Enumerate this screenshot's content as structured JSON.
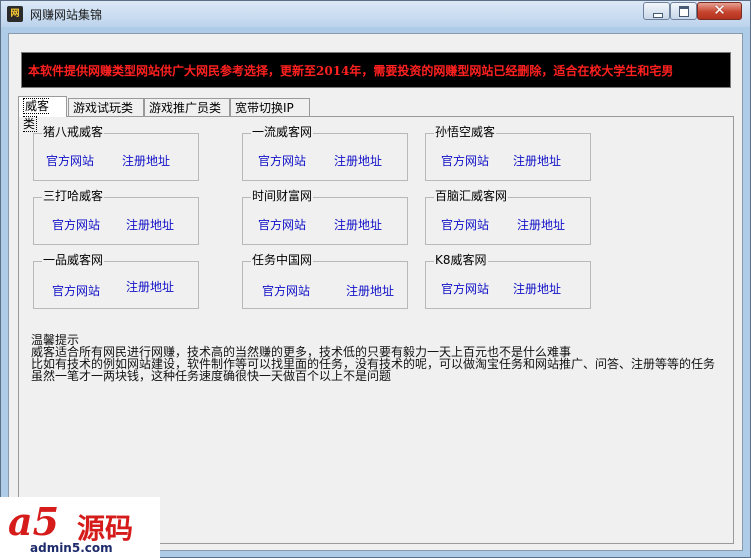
{
  "window": {
    "title": "网赚网站集锦"
  },
  "banner": {
    "text": "本软件提供网赚类型网站供广大网民参考选择，更新至2014年，需要投资的网赚型网站已经删除，适合在校大学生和宅男"
  },
  "tabs": [
    {
      "label": "威客类"
    },
    {
      "label": "游戏试玩类"
    },
    {
      "label": "游戏推广员类"
    },
    {
      "label": "宽带切换IP"
    }
  ],
  "sites": [
    {
      "name": "猪八戒威客",
      "official": "官方网站",
      "register": "注册地址"
    },
    {
      "name": "一流威客网",
      "official": "官方网站",
      "register": "注册地址"
    },
    {
      "name": "孙悟空威客",
      "official": "官方网站",
      "register": "注册地址"
    },
    {
      "name": "三打哈威客",
      "official": "官方网站",
      "register": "注册地址"
    },
    {
      "name": "时间财富网",
      "official": "官方网站",
      "register": "注册地址"
    },
    {
      "name": "百脑汇威客网",
      "official": "官方网站",
      "register": "注册地址"
    },
    {
      "name": "一品威客网",
      "official": "官方网站",
      "register": "注册地址"
    },
    {
      "name": "任务中国网",
      "official": "官方网站",
      "register": "注册地址"
    },
    {
      "name": "K8威客网",
      "official": "官方网站",
      "register": "注册地址"
    }
  ],
  "tips": {
    "title": "温馨提示",
    "lines": [
      "威客适合所有网民进行网赚，技术高的当然赚的更多，技术低的只要有毅力一天上百元也不是什么难事",
      "比如有技术的例如网站建设，软件制作等可以找里面的任务，没有技术的呢，可以做淘宝任务和网站推广、问答、注册等等的任务",
      "虽然一笔才一两块钱，这种任务速度确很快一天做百个以上不是问题"
    ]
  },
  "watermark": {
    "logo": "a5",
    "brand": "源码",
    "url": "admin5.com"
  }
}
